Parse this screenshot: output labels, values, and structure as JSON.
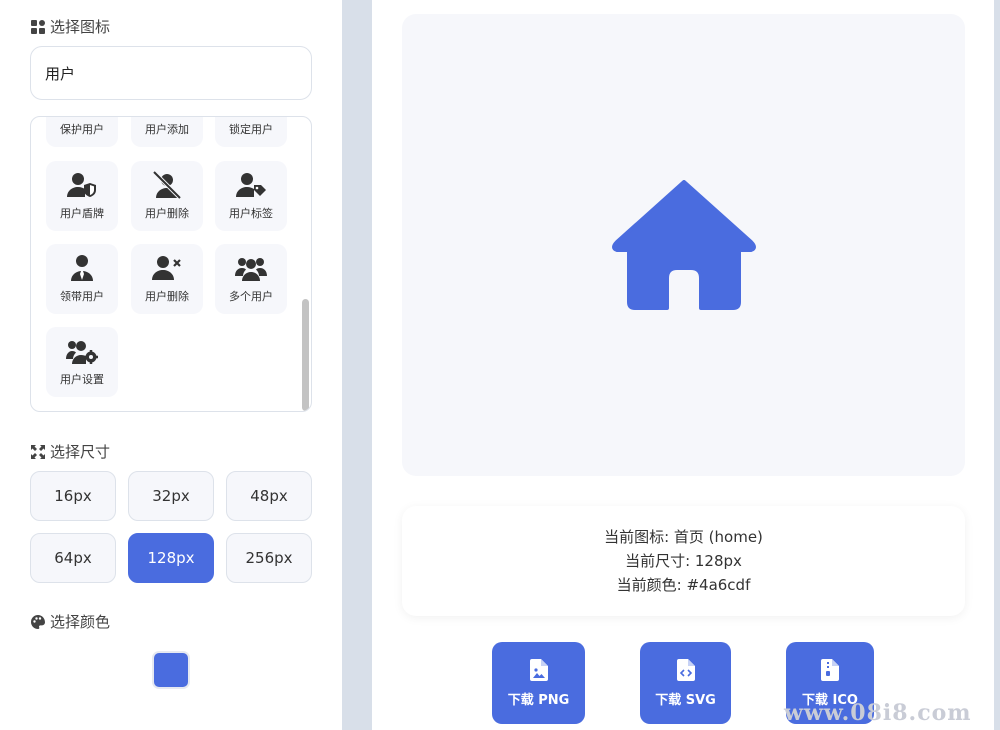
{
  "sidebar": {
    "icon_section_title": "选择图标",
    "search": {
      "value": "用户",
      "placeholder": ""
    },
    "icons": [
      {
        "label": "保护用户"
      },
      {
        "label": "用户添加"
      },
      {
        "label": "锁定用户"
      },
      {
        "label": "用户盾牌"
      },
      {
        "label": "用户删除"
      },
      {
        "label": "用户标签"
      },
      {
        "label": "领带用户"
      },
      {
        "label": "用户删除"
      },
      {
        "label": "多个用户"
      },
      {
        "label": "用户设置"
      }
    ],
    "size_section_title": "选择尺寸",
    "sizes": [
      {
        "label": "16px"
      },
      {
        "label": "32px"
      },
      {
        "label": "48px"
      },
      {
        "label": "64px"
      },
      {
        "label": "128px"
      },
      {
        "label": "256px"
      }
    ],
    "selected_size": "128px",
    "color_section_title": "选择颜色",
    "selected_color": "#4a6cdf"
  },
  "info": {
    "current_icon": "当前图标: 首页 (home)",
    "current_size": "当前尺寸: 128px",
    "current_color": "当前颜色: #4a6cdf"
  },
  "downloads": {
    "png_label": "下载 PNG",
    "svg_label": "下载 SVG",
    "ico_label": "下载 ICO"
  },
  "watermark": "www.08i8.com"
}
